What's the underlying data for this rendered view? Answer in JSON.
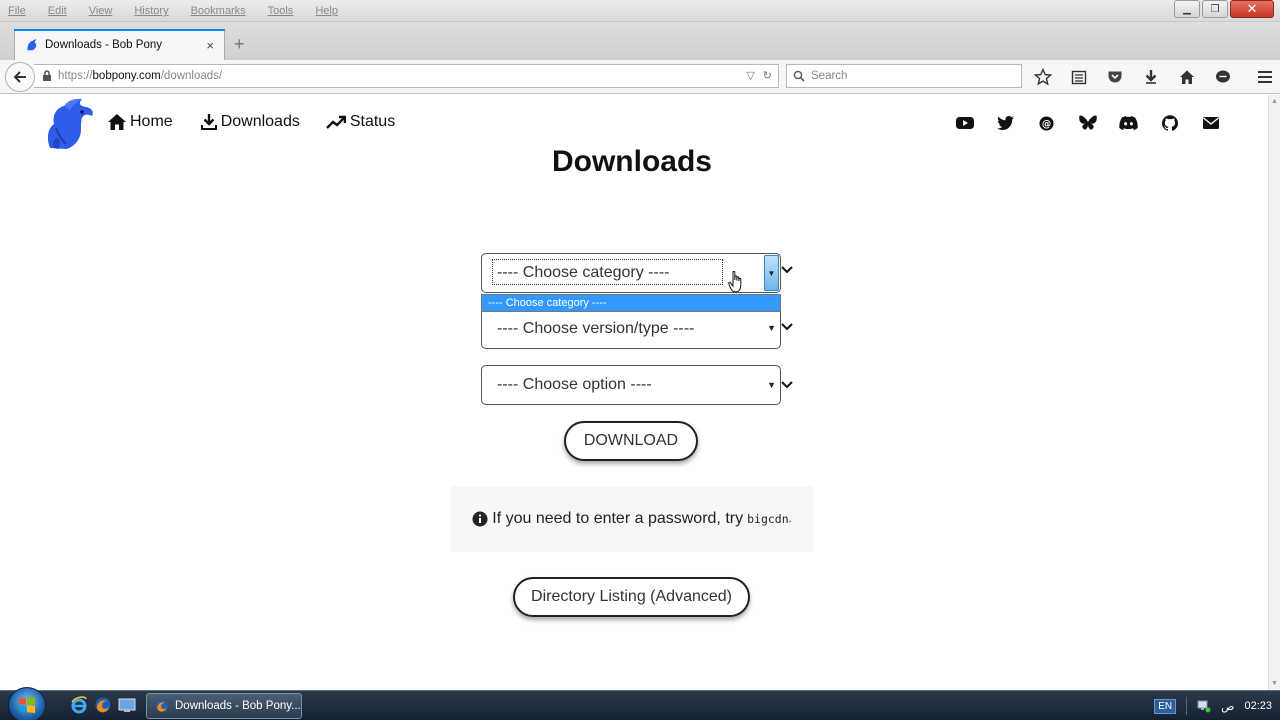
{
  "browser": {
    "menu": [
      "File",
      "Edit",
      "View",
      "History",
      "Bookmarks",
      "Tools",
      "Help"
    ],
    "tab": {
      "title": "Downloads - Bob Pony",
      "close": "×"
    },
    "new_tab": "+",
    "url": {
      "prefix": "https://",
      "host": "bobpony.com",
      "path": "/downloads/"
    },
    "search": {
      "placeholder": "Search"
    },
    "accent": "#0a84ff"
  },
  "site": {
    "nav": [
      {
        "label": "Home",
        "icon": "home-icon"
      },
      {
        "label": "Downloads",
        "icon": "download-icon"
      },
      {
        "label": "Status",
        "icon": "trending-up-icon"
      }
    ],
    "social": [
      "youtube-icon",
      "twitter-icon",
      "mastodon-icon",
      "bluesky-icon",
      "discord-icon",
      "github-icon",
      "email-icon"
    ],
    "brand_color": "#2f5ce8"
  },
  "main": {
    "title": "Downloads",
    "category_select": {
      "value": "---- Choose category ----",
      "open_option": "---- Choose category ----"
    },
    "version_select": {
      "value": "---- Choose version/type ----"
    },
    "option_select": {
      "value": "---- Choose option ----"
    },
    "download_button": "DOWNLOAD",
    "info": {
      "text": "If you need to enter a password, try",
      "code": "bigcdn",
      "suffix": "."
    },
    "directory_button": "Directory Listing (Advanced)"
  },
  "taskbar": {
    "task": "Downloads - Bob Pony...",
    "lang": "EN",
    "time": "02:23",
    "ampm": "ص"
  }
}
